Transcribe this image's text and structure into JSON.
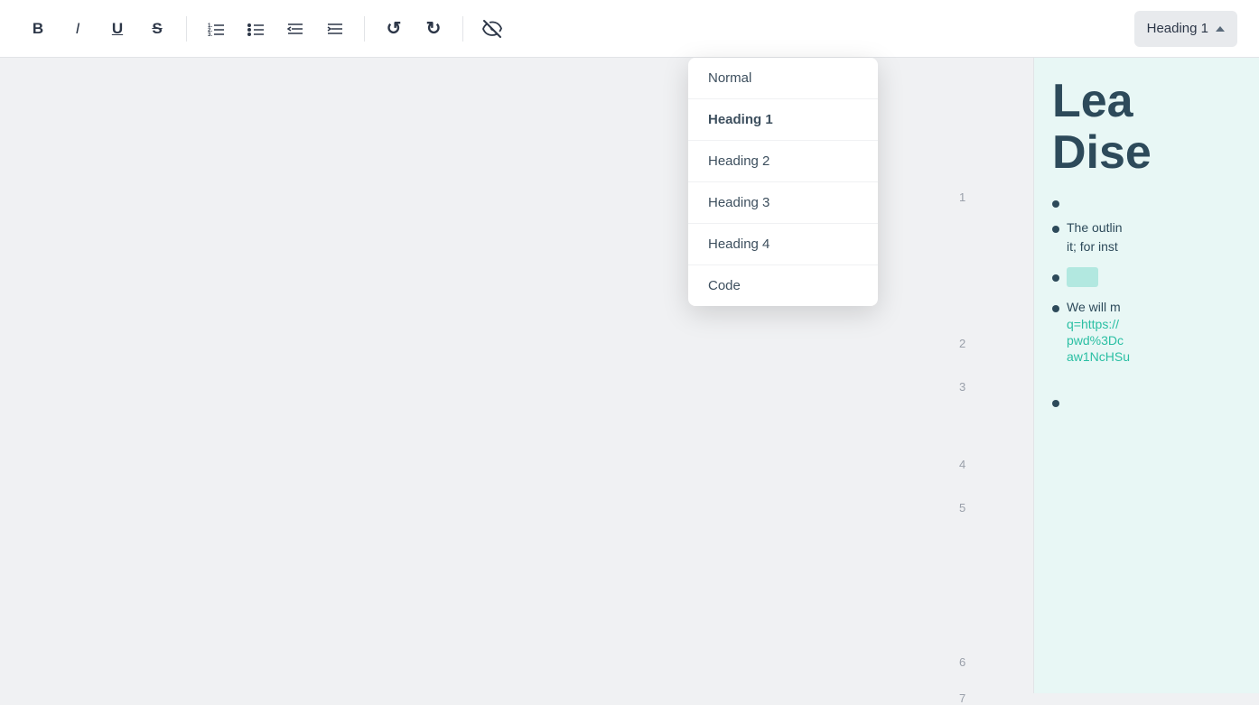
{
  "toolbar": {
    "bold_label": "B",
    "italic_label": "I",
    "underline_label": "U",
    "strikethrough_label": "S",
    "undo_label": "↺",
    "redo_label": "↻",
    "style_dropdown_label": "Heading 1"
  },
  "dropdown": {
    "items": [
      {
        "id": "normal",
        "label": "Normal",
        "active": false
      },
      {
        "id": "heading1",
        "label": "Heading 1",
        "active": true
      },
      {
        "id": "heading2",
        "label": "Heading 2",
        "active": false
      },
      {
        "id": "heading3",
        "label": "Heading 3",
        "active": false
      },
      {
        "id": "heading4",
        "label": "Heading 4",
        "active": false
      },
      {
        "id": "code",
        "label": "Code",
        "active": false
      }
    ]
  },
  "line_numbers": [
    "1",
    "2",
    "3",
    "4",
    "5",
    "6",
    "7"
  ],
  "preview": {
    "heading": "Lea\nDise",
    "bullets": [
      {
        "type": "empty"
      },
      {
        "type": "text",
        "content": "The outlin it; for inst"
      },
      {
        "type": "highlight",
        "content": ""
      },
      {
        "type": "text_link",
        "text": "We will m",
        "link": "q=https://...pwd%3Dc...aw1NcHSu"
      }
    ]
  },
  "colors": {
    "accent": "#2abfa3",
    "heading_color": "#2d4a5a",
    "preview_bg": "#e8f7f5",
    "toolbar_bg": "#ffffff",
    "editor_bg": "#f0f1f3",
    "dropdown_bg": "#ffffff",
    "active_item_color": "#2d4a5a"
  }
}
